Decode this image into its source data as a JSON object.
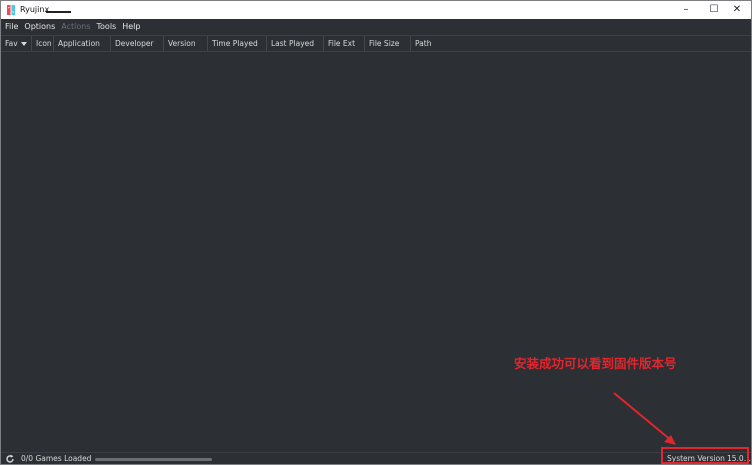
{
  "window": {
    "title": "Ryujinx",
    "controls": {
      "minimize": "–",
      "maximize": "☐",
      "close": "✕"
    }
  },
  "menu": [
    {
      "label": "File",
      "enabled": true
    },
    {
      "label": "Options",
      "enabled": true
    },
    {
      "label": "Actions",
      "enabled": false
    },
    {
      "label": "Tools",
      "enabled": true
    },
    {
      "label": "Help",
      "enabled": true
    }
  ],
  "columns": [
    {
      "label": "Fav",
      "sorted": true
    },
    {
      "label": "Icon"
    },
    {
      "label": "Application"
    },
    {
      "label": "Developer"
    },
    {
      "label": "Version"
    },
    {
      "label": "Time Played"
    },
    {
      "label": "Last Played"
    },
    {
      "label": "File Ext"
    },
    {
      "label": "File Size"
    },
    {
      "label": "Path"
    }
  ],
  "games": [],
  "status": {
    "games_loaded": "0/0 Games Loaded",
    "progress": 0,
    "system_version_label": "System Version",
    "system_version_value": "15.0.1"
  },
  "annotation": {
    "text": "安装成功可以看到固件版本号",
    "color": "#e0262e"
  },
  "colors": {
    "background": "#2c2f33",
    "text": "#d9d9d9",
    "disabled_text": "#6d7075",
    "logo_red": "#ee4a55",
    "logo_blue": "#4bc8e8"
  }
}
